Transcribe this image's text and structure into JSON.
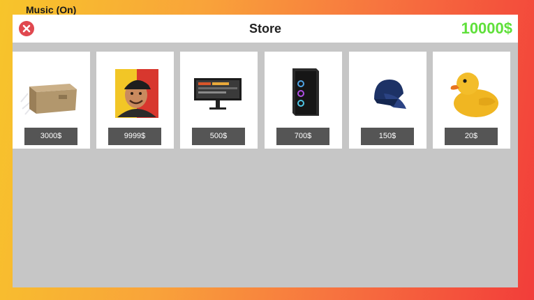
{
  "music_label": "Music (On)",
  "store": {
    "title": "Store",
    "money": "10000$",
    "money_color": "#5fe03a",
    "close_color": "#e0484f",
    "items": [
      {
        "icon": "cardboard-box-icon",
        "price": "3000$"
      },
      {
        "icon": "youtuber-portrait-icon",
        "price": "9999$"
      },
      {
        "icon": "monitor-icon",
        "price": "500$"
      },
      {
        "icon": "pc-tower-icon",
        "price": "700$"
      },
      {
        "icon": "baseball-cap-icon",
        "price": "150$"
      },
      {
        "icon": "rubber-duck-icon",
        "price": "20$"
      }
    ]
  }
}
